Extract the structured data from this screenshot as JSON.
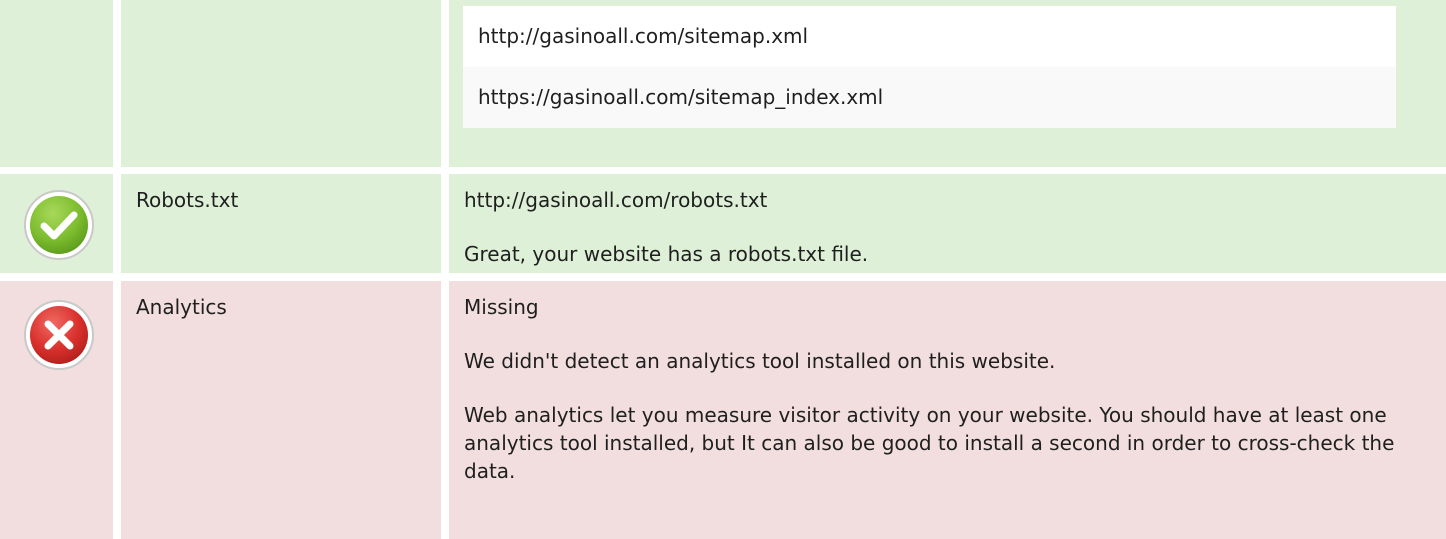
{
  "colors": {
    "success_bg": "#dff0d8",
    "error_bg": "#f2dede",
    "check_green": "#7dbd2f",
    "cross_red": "#d9302c"
  },
  "sitemaps": {
    "items": [
      "http://gasinoall.com/sitemap.xml",
      "https://gasinoall.com/sitemap_index.xml"
    ]
  },
  "robots": {
    "status_icon": "check-icon",
    "label": "Robots.txt",
    "url": "http://gasinoall.com/robots.txt",
    "message": "Great, your website has a robots.txt file."
  },
  "analytics": {
    "status_icon": "cross-icon",
    "label": "Analytics",
    "value": "Missing",
    "message": "We didn't detect an analytics tool installed on this website.",
    "advice": "Web analytics let you measure visitor activity on your website. You should have at least one analytics tool installed, but It can also be good to install a second in order to cross-check the data."
  }
}
